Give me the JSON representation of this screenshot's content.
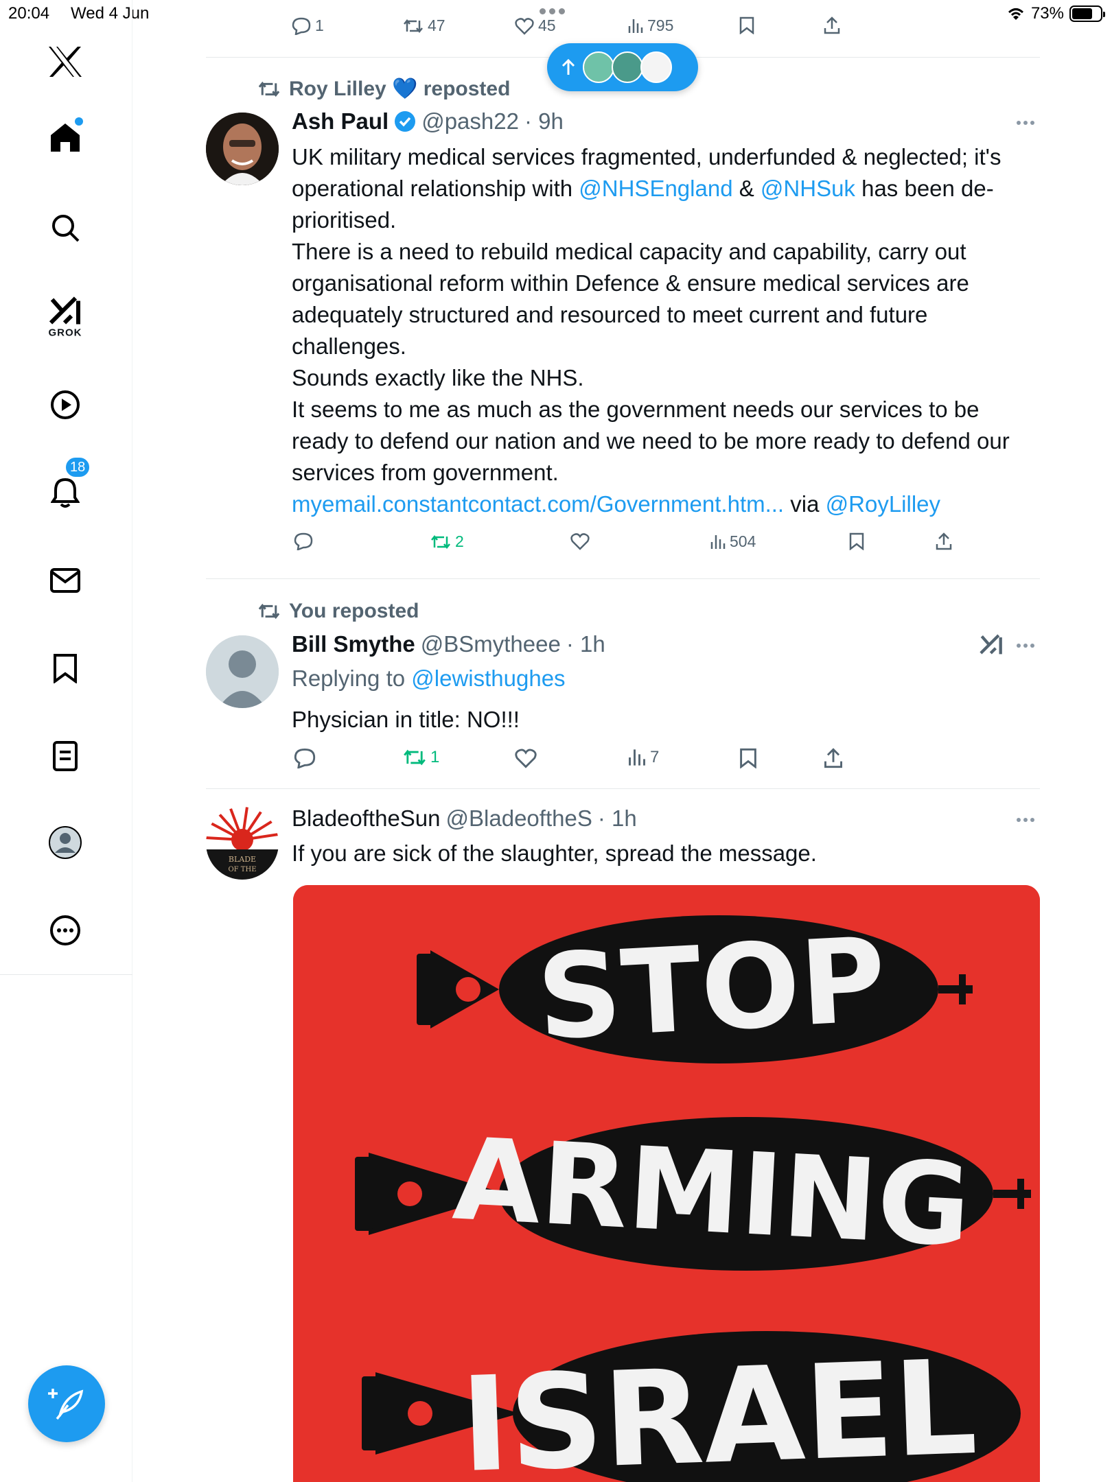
{
  "status_bar": {
    "time": "20:04",
    "date": "Wed 4 Jun",
    "battery": "73%",
    "battery_level": 0.73
  },
  "sidebar": {
    "items": [
      {
        "name": "logo",
        "icon": "x-logo-icon"
      },
      {
        "name": "home",
        "icon": "home-icon",
        "has_dot": true
      },
      {
        "name": "search",
        "icon": "search-icon"
      },
      {
        "name": "grok",
        "icon": "grok-icon",
        "label": "GROK"
      },
      {
        "name": "videos",
        "icon": "play-icon"
      },
      {
        "name": "notifications",
        "icon": "bell-icon",
        "badge": "18"
      },
      {
        "name": "messages",
        "icon": "mail-icon"
      },
      {
        "name": "bookmarks",
        "icon": "bookmark-icon"
      },
      {
        "name": "lists",
        "icon": "list-icon"
      },
      {
        "name": "profile",
        "icon": "avatar-icon"
      },
      {
        "name": "more",
        "icon": "more-circle-icon"
      }
    ],
    "compose_icon": "compose-icon"
  },
  "top_partial": {
    "reply": "1",
    "reposts": "47",
    "likes": "45",
    "views": "795"
  },
  "tweets": [
    {
      "repost_by": "Roy Lilley 💙 reposted",
      "name": "Ash Paul",
      "verified": true,
      "handle": "@pash22",
      "time": "· 9h",
      "text_lines": {
        "l1": "UK military medical services fragmented, underfunded &  neglected; it's",
        "l2a": "operational relationship with ",
        "l2b": "@NHSEngland",
        "l2c": " & ",
        "l2d": "@NHSuk",
        "l2e": " has been de-",
        "l3": "prioritised.",
        "l4": "There is a need to rebuild medical capacity and capability, carry out",
        "l5": "organisational reform within Defence & ensure medical services are",
        "l6": "adequately structured and resourced to meet current and future",
        "l7": "challenges.",
        "l8": "Sounds exactly like the NHS.",
        "l9": "It seems to me as much as the government needs our services to be",
        "l10": "ready to defend our nation and  we need to be more ready to defend our",
        "l11": "services from government.",
        "l12a": "myemail.constantcontact.com/Government.htm...",
        "l12b": " via ",
        "l12c": "@RoyLilley"
      },
      "reposts": "2",
      "views": "504"
    },
    {
      "repost_by": "You reposted",
      "name": "Bill Smythe",
      "handle": "@BSmytheee",
      "time": "· 1h",
      "replying_prefix": "Replying to ",
      "replying_to": "@lewisthughes",
      "text": "Physician in title: NO!!!",
      "reposts": "1",
      "views": "7"
    },
    {
      "name": "BladeoftheSun",
      "handle": "@BladeoftheS",
      "time": "· 1h",
      "text": "If you are sick of the slaughter, spread the message.",
      "media_text": {
        "line1": "STOP",
        "line2": "ARMING",
        "line3": "ISRAEL"
      },
      "avatar_text": {
        "line1": "BLADE",
        "line2": "OF THE"
      }
    }
  ],
  "colors": {
    "accent": "#1d9bf0",
    "repost_green": "#00ba7c",
    "muted": "#536471",
    "media_red": "#e6322b"
  }
}
